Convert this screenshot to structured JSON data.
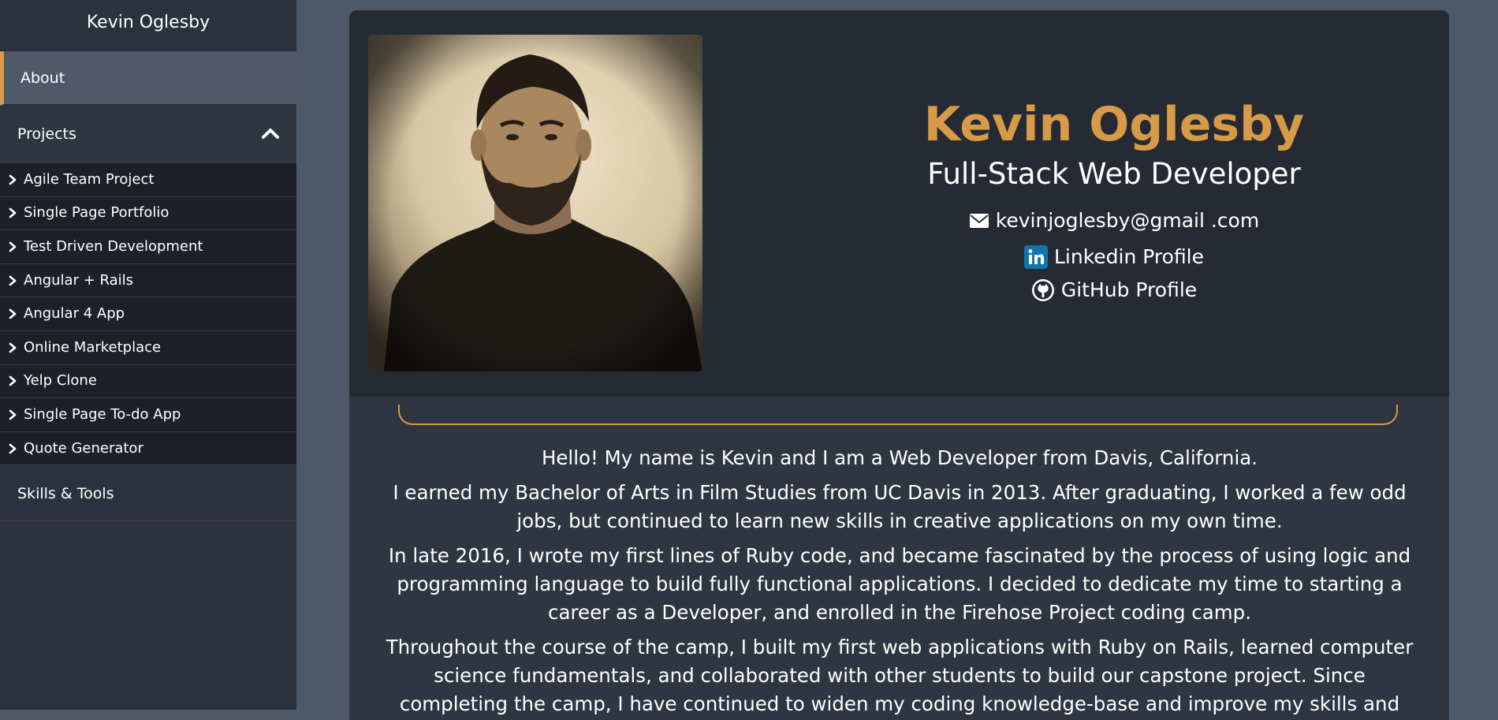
{
  "sidebar": {
    "title": "Kevin Oglesby",
    "about_label": "About",
    "projects_label": "Projects",
    "projects": [
      "Agile Team Project",
      "Single Page Portfolio",
      "Test Driven Development",
      "Angular + Rails",
      "Angular 4 App",
      "Online Marketplace",
      "Yelp Clone",
      "Single Page To-do App",
      "Quote Generator"
    ],
    "skills_label": "Skills & Tools"
  },
  "profile": {
    "name": "Kevin Oglesby",
    "role": "Full-Stack Web Developer",
    "email": "kevinjoglesby@gmail .com",
    "linkedin": "Linkedin Profile",
    "github": "GitHub Profile"
  },
  "bio": {
    "p1": "Hello! My name is Kevin and I am a Web Developer from Davis, California.",
    "p2": "I earned my Bachelor of Arts in Film Studies from UC Davis in 2013. After graduating, I worked a few odd jobs, but continued to learn new skills in creative applications on my own time.",
    "p3": "In late 2016, I wrote my first lines of Ruby code, and became fascinated by the process of using logic and programming language to build fully functional applications. I decided to dedicate my time to starting a career as a Developer, and enrolled in the Firehose Project coding camp.",
    "p4": "Throughout the course of the camp, I built my first web applications with Ruby on Rails, learned computer science fundamentals, and collaborated with other students to build our capstone project. Since completing the camp, I have continued to widen my coding knowledge-base and improve my skills and practices, to be"
  },
  "colors": {
    "accent": "#d79a46",
    "sidebar_bg": "#2b323d",
    "card_head_bg": "#262b33",
    "page_bg": "#4d5869"
  },
  "icons": {
    "projects_toggle": "chevron-up-icon",
    "project_arrow": "chevron-right-icon",
    "email": "envelope-icon",
    "linkedin": "linkedin-icon",
    "github": "github-icon"
  }
}
